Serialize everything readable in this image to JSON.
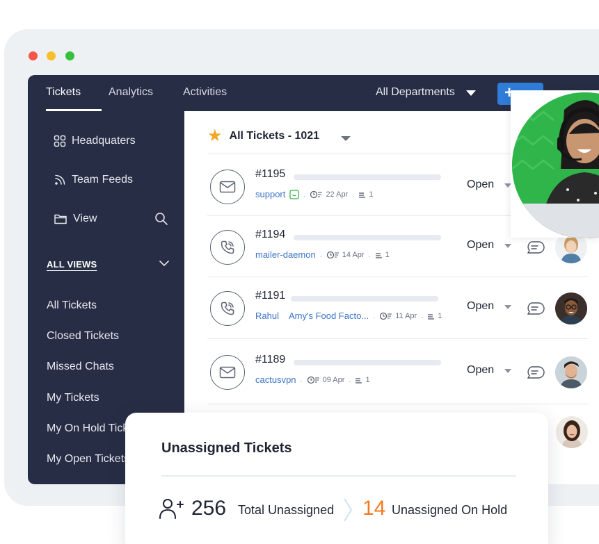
{
  "window": {
    "traffic_lights": [
      "close",
      "minimize",
      "maximize"
    ]
  },
  "topbar": {
    "tabs": [
      {
        "label": "Tickets",
        "active": true
      },
      {
        "label": "Analytics",
        "active": false
      },
      {
        "label": "Activities",
        "active": false
      }
    ],
    "department_label": "All Departments",
    "add_label": "+"
  },
  "sidebar": {
    "items": [
      {
        "label": "Headquaters",
        "icon": "grid-icon"
      },
      {
        "label": "Team Feeds",
        "icon": "feed-icon"
      },
      {
        "label": "View",
        "icon": "folder-icon"
      }
    ],
    "all_views_label": "ALL VIEWS",
    "views": [
      "All Tickets",
      "Closed Tickets",
      "Missed Chats",
      "My Tickets",
      "My On Hold Tickets",
      "My Open Tickets"
    ]
  },
  "list": {
    "title": "All Tickets - 1021",
    "tickets": [
      {
        "id": "#1195",
        "channel": "email",
        "contact": "support",
        "account": "",
        "date": "22 Apr",
        "count": "1",
        "status": "Open"
      },
      {
        "id": "#1194",
        "channel": "phone",
        "contact": "mailer-daemon",
        "account": "",
        "date": "14 Apr",
        "count": "1",
        "status": "Open"
      },
      {
        "id": "#1191",
        "channel": "phone",
        "contact": "Rahul",
        "account": "Amy's Food Facto...",
        "date": "11 Apr",
        "count": "1",
        "status": "Open"
      },
      {
        "id": "#1189",
        "channel": "email",
        "contact": "cactusvpn",
        "account": "",
        "date": "09 Apr",
        "count": "1",
        "status": "Open"
      }
    ]
  },
  "unassigned": {
    "title": "Unassigned Tickets",
    "total_value": "256",
    "total_label": "Total Unassigned",
    "onhold_value": "14",
    "onhold_label": "Unassigned On Hold"
  },
  "colors": {
    "navy": "#262d44",
    "accent_blue": "#2f7dd8",
    "link_blue": "#3a73c4",
    "orange": "#f37b22",
    "star": "#f5a623",
    "photo_green": "#2fb54a"
  }
}
